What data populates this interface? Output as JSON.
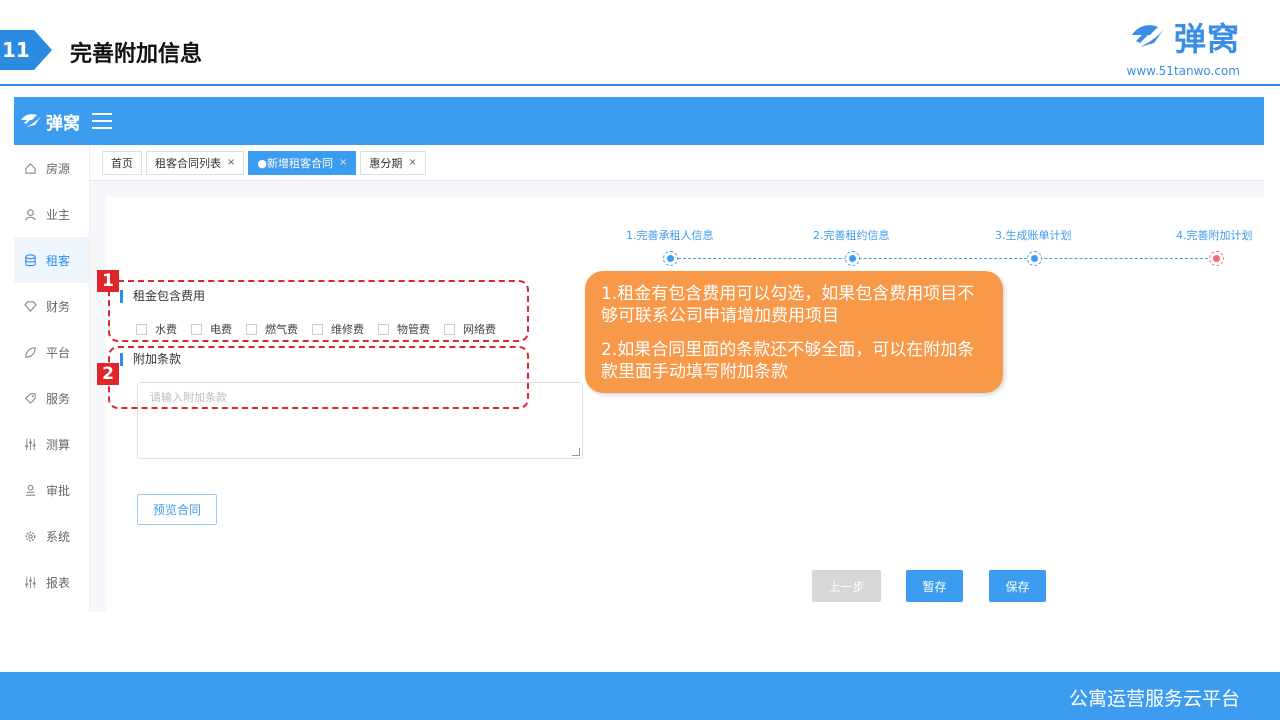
{
  "slide": {
    "number": "11",
    "title": "完善附加信息",
    "brand": "弹窝",
    "url": "www.51tanwo.com",
    "footer": "公寓运营服务云平台"
  },
  "colors": {
    "accent": "#3c9cef",
    "annotation": "#e0262c",
    "callout": "#f8994a"
  },
  "app": {
    "brand": "弹窝",
    "sidebar": [
      {
        "label": "房源",
        "icon": "home-icon"
      },
      {
        "label": "业主",
        "icon": "user-icon"
      },
      {
        "label": "租客",
        "icon": "database-icon",
        "active": true
      },
      {
        "label": "财务",
        "icon": "diamond-icon"
      },
      {
        "label": "平台",
        "icon": "leaf-icon"
      },
      {
        "label": "服务",
        "icon": "tag-icon"
      },
      {
        "label": "测算",
        "icon": "sliders-icon"
      },
      {
        "label": "审批",
        "icon": "approver-icon"
      },
      {
        "label": "系统",
        "icon": "gear-icon"
      },
      {
        "label": "报表",
        "icon": "sliders-icon"
      }
    ],
    "tabs": [
      {
        "label": "首页",
        "closable": false
      },
      {
        "label": "租客合同列表",
        "closable": true
      },
      {
        "label": "●新增租客合同",
        "closable": true,
        "active": true
      },
      {
        "label": "惠分期",
        "closable": true
      }
    ],
    "steps": [
      {
        "label": "1.完善承租人信息"
      },
      {
        "label": "2.完善租约信息"
      },
      {
        "label": "3.生成账单计划"
      },
      {
        "label": "4.完善附加计划",
        "current": true
      }
    ],
    "fees_section": {
      "title": "租金包含费用",
      "options": [
        "水费",
        "电费",
        "燃气费",
        "维修费",
        "物管费",
        "网络费"
      ]
    },
    "terms_section": {
      "title": "附加条款",
      "placeholder": "请输入附加条款"
    },
    "buttons": {
      "preview": "预览合同",
      "prev": "上一步",
      "save_draft": "暂存",
      "save": "保存"
    }
  },
  "annotations": {
    "badge1": "1",
    "badge2": "2",
    "callout_line1": "1.租金有包含费用可以勾选，如果包含费用项目不够可联系公司申请增加费用项目",
    "callout_line2": "2.如果合同里面的条款还不够全面，可以在附加条款里面手动填写附加条款"
  }
}
